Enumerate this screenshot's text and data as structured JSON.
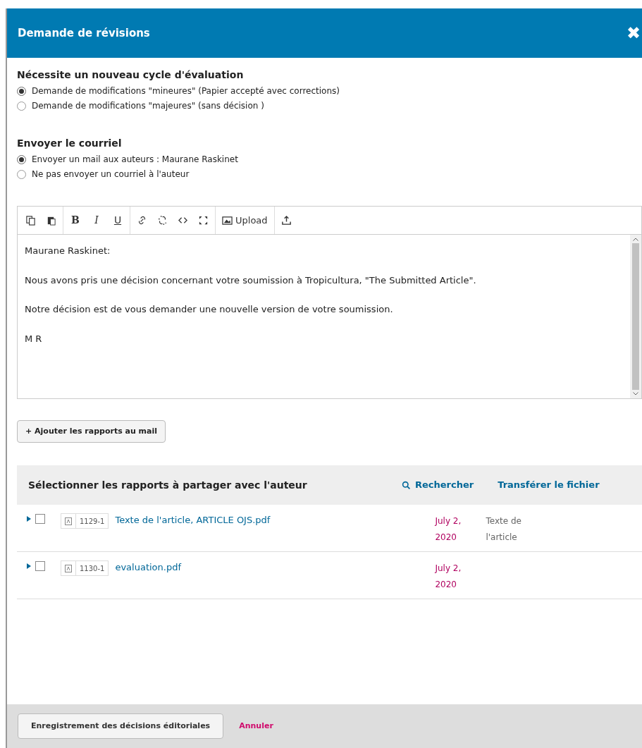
{
  "modal": {
    "title": "Demande de révisions",
    "close": "✖"
  },
  "review_round": {
    "heading": "Nécessite un nouveau cycle d'évaluation",
    "options": [
      {
        "label": "Demande de modifications \"mineures\" (Papier accepté avec corrections)",
        "selected": true
      },
      {
        "label": "Demande de modifications \"majeures\" (sans décision )",
        "selected": false
      }
    ]
  },
  "email": {
    "heading": "Envoyer le courriel",
    "options": [
      {
        "label": "Envoyer un mail aux auteurs : Maurane Raskinet",
        "selected": true
      },
      {
        "label": "Ne pas envoyer un courriel à l'auteur",
        "selected": false
      }
    ]
  },
  "editor": {
    "toolbar": [
      {
        "kind": "copy"
      },
      {
        "kind": "paste"
      },
      {
        "kind": "sep"
      },
      {
        "kind": "bold",
        "label": "B"
      },
      {
        "kind": "italic",
        "label": "I"
      },
      {
        "kind": "underline",
        "label": "U"
      },
      {
        "kind": "sep"
      },
      {
        "kind": "link"
      },
      {
        "kind": "unlink"
      },
      {
        "kind": "code"
      },
      {
        "kind": "fullscreen"
      },
      {
        "kind": "sep"
      },
      {
        "kind": "image",
        "label": "Upload"
      },
      {
        "kind": "sep"
      },
      {
        "kind": "upload"
      }
    ],
    "paragraphs": [
      "Maurane Raskinet:",
      "Nous avons pris une décision concernant votre soumission à Tropicultura, \"The Submitted Article\".",
      "Notre décision est de vous demander une nouvelle version de votre soumission.",
      "M R"
    ]
  },
  "add_reports_button": "+ Ajouter les rapports au mail",
  "files": {
    "title": "Sélectionner les rapports à partager avec l'auteur",
    "actions": [
      {
        "kind": "search",
        "label": "Rechercher"
      },
      {
        "kind": "plain",
        "label": "Transférer le fichier"
      }
    ],
    "rows": [
      {
        "checked": false,
        "id": "1129-1",
        "name": "Texte de l'article, ARTICLE OJS.pdf",
        "date": "July 2, 2020",
        "type": "Texte de l'article"
      },
      {
        "checked": false,
        "id": "1130-1",
        "name": "evaluation.pdf",
        "date": "July 2, 2020"
      }
    ]
  },
  "footer": {
    "save": "Enregistrement des décisions éditoriales",
    "cancel": "Annuler"
  }
}
